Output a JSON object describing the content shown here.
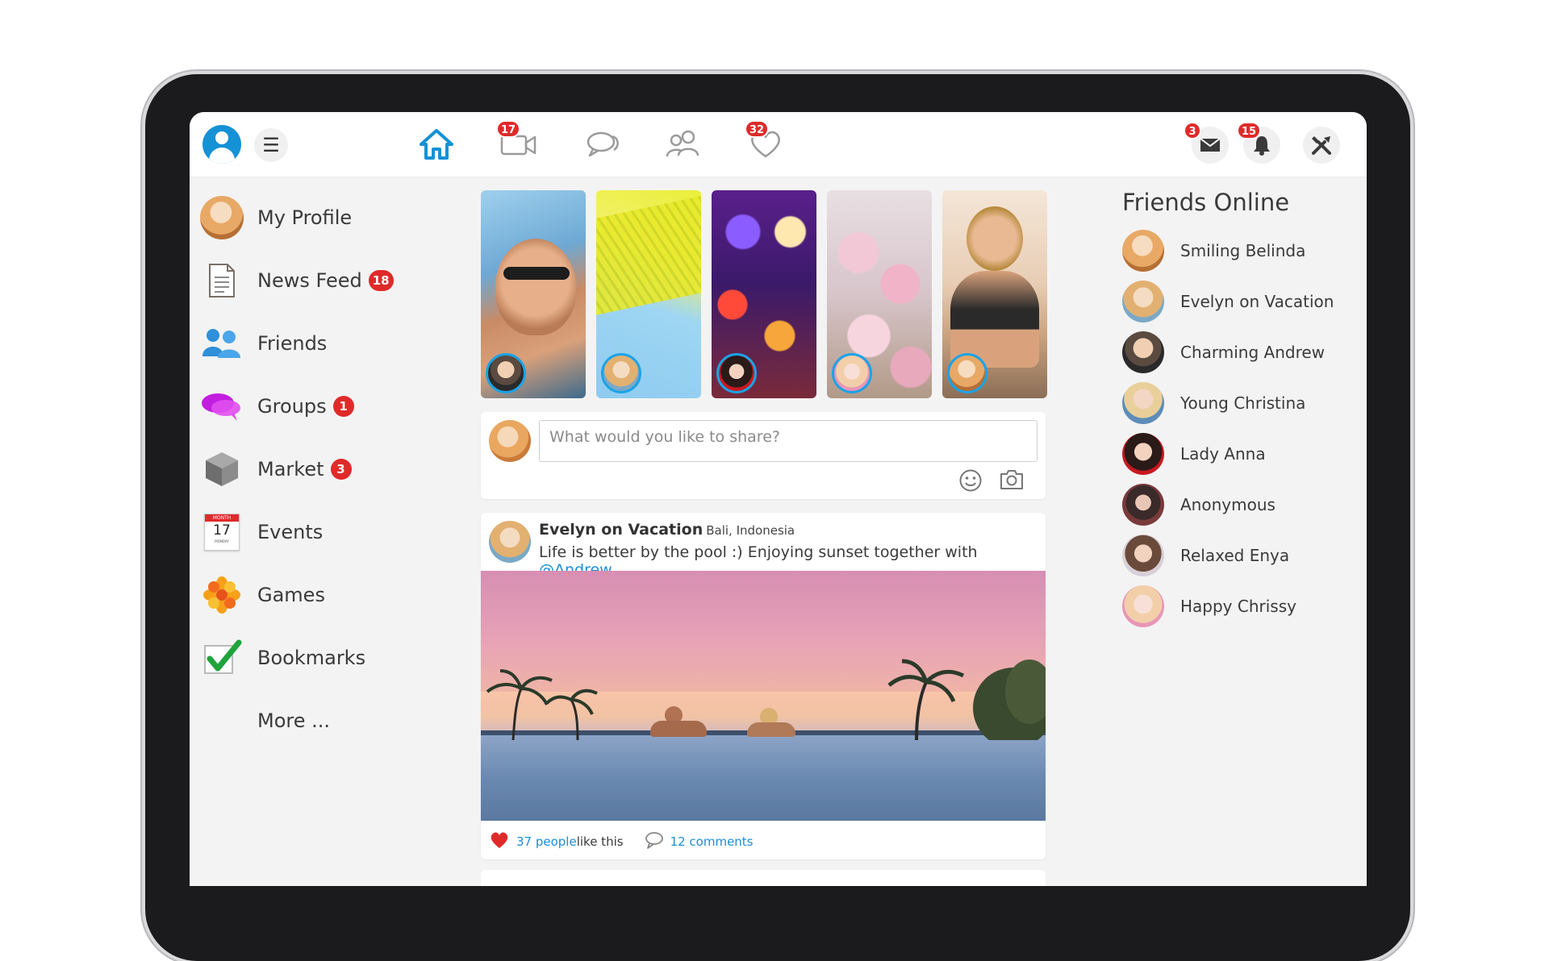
{
  "topbar": {
    "badges": {
      "video": "17",
      "likes": "32",
      "messages": "3",
      "notifications": "15"
    }
  },
  "sidebar": {
    "items": [
      {
        "label": "My Profile",
        "badge": ""
      },
      {
        "label": "News Feed",
        "badge": "18"
      },
      {
        "label": "Friends",
        "badge": ""
      },
      {
        "label": "Groups",
        "badge": "1"
      },
      {
        "label": "Market",
        "badge": "3"
      },
      {
        "label": "Events",
        "badge": ""
      },
      {
        "label": "Games",
        "badge": ""
      },
      {
        "label": "Bookmarks",
        "badge": ""
      },
      {
        "label": "More ...",
        "badge": ""
      }
    ],
    "events_calendar": {
      "month": "MONTH",
      "day": "17",
      "weekday": "MONDAY"
    }
  },
  "composer": {
    "placeholder": "What would you like to share?"
  },
  "post": {
    "author": "Evelyn on Vacation",
    "location": "Bali, Indonesia",
    "text": "Life is better by the pool :) Enjoying sunset together with ",
    "mention": "@Andrew",
    "likes_count": "37 people",
    "likes_suffix": " like this",
    "comments": "12 comments"
  },
  "friends_online": {
    "title": "Friends Online",
    "friends": [
      "Smiling Belinda",
      "Evelyn on Vacation",
      "Charming Andrew",
      "Young Christina",
      "Lady Anna",
      "Anonymous",
      "Relaxed Enya",
      "Happy Chrissy"
    ]
  },
  "colors": {
    "accent_blue": "#1591d6",
    "badge_red": "#e02a2a",
    "link_blue": "#1a8fd8"
  },
  "icons": {
    "topbar": [
      "user-avatar-icon",
      "hamburger-menu-icon",
      "home-icon",
      "video-icon",
      "chat-bubbles-icon",
      "people-icon",
      "heart-icon",
      "envelope-icon",
      "bell-icon",
      "tools-icon"
    ],
    "composer": [
      "smiley-icon",
      "camera-icon"
    ],
    "post": [
      "heart-icon",
      "comment-icon"
    ]
  }
}
